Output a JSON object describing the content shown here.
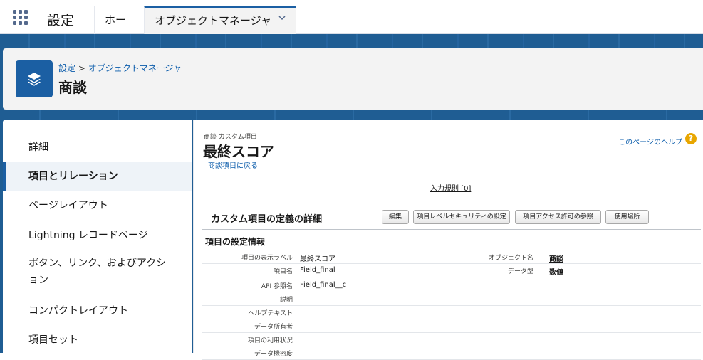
{
  "topnav": {
    "app_name": "設定",
    "tabs": [
      {
        "label": "ホーム"
      },
      {
        "label": "オブジェクトマネージャ"
      }
    ]
  },
  "header": {
    "breadcrumb_root": "設定",
    "breadcrumb_sep": ">",
    "breadcrumb_child": "オブジェクトマネージャ",
    "title": "商談",
    "icon": "layers-icon"
  },
  "sidebar": {
    "items": [
      {
        "label": "詳細"
      },
      {
        "label": "項目とリレーション",
        "active": true
      },
      {
        "label": "ページレイアウト"
      },
      {
        "label": "Lightning レコードページ"
      },
      {
        "label": "ボタン、リンク、およびアクシ"
      },
      {
        "label": "ョン"
      },
      {
        "label": "コンパクトレイアウト"
      },
      {
        "label": "項目セット"
      }
    ]
  },
  "content": {
    "object_subtitle": "商談 カスタム項目",
    "field_title": "最終スコア",
    "back_link": "商談項目に戻る",
    "help_link": "このページのヘルプ",
    "help_icon": "?",
    "validation_rules": "入力規則 [0]",
    "section_title": "カスタム項目の定義の詳細",
    "buttons": {
      "edit": "編集",
      "field_security": "項目レベルセキュリティの設定",
      "field_access": "項目アクセス許可の参照",
      "where_used": "使用場所"
    },
    "info_heading": "項目の設定情報",
    "rows": [
      {
        "label": "項目の表示ラベル",
        "value": "最終スコア",
        "label2": "オブジェクト名",
        "value2": "商談"
      },
      {
        "label": "項目名",
        "value": "Field_final",
        "label2": "データ型",
        "value2": "数値"
      },
      {
        "label": "API 参照名",
        "value": "Field_final__c"
      },
      {
        "label": "説明",
        "value": ""
      },
      {
        "label": "ヘルプテキスト",
        "value": ""
      },
      {
        "label": "データ所有者",
        "value": ""
      },
      {
        "label": "項目の利用状況",
        "value": ""
      },
      {
        "label": "データ機密度",
        "value": ""
      }
    ]
  },
  "colors": {
    "brand_blue": "#1b5fa3",
    "band_blue": "#1f5d93",
    "link_blue": "#0b5cab"
  }
}
